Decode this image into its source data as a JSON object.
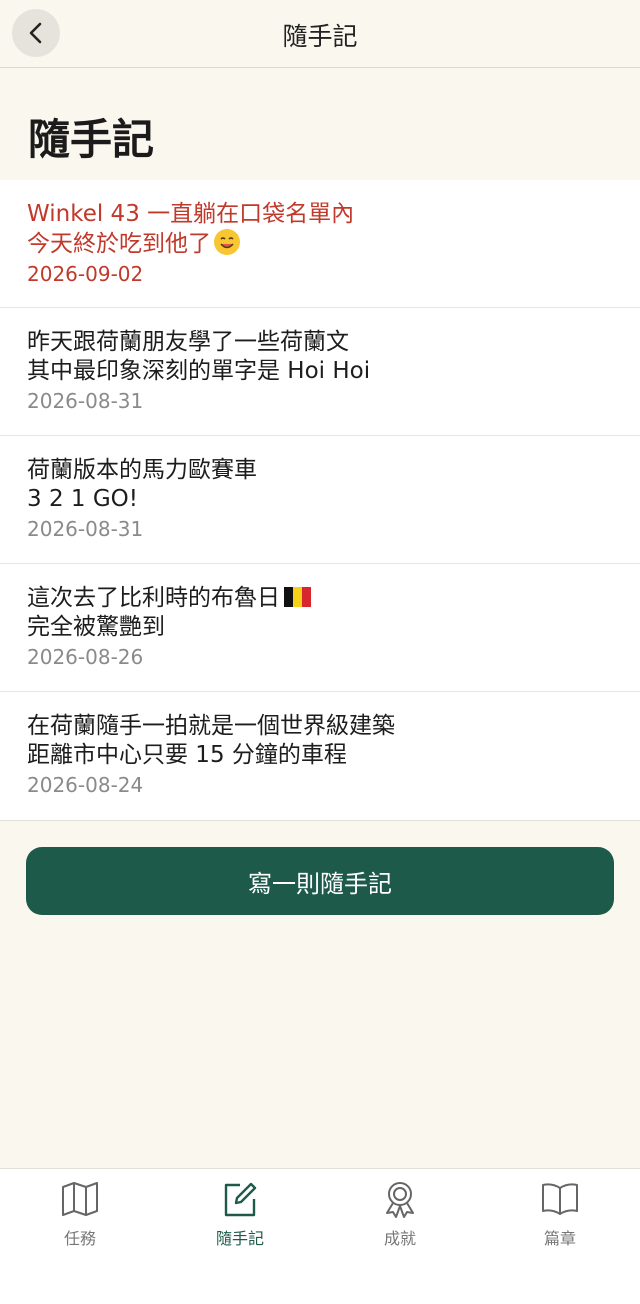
{
  "header": {
    "title": "隨手記"
  },
  "page": {
    "title": "隨手記"
  },
  "notes": [
    {
      "line1": "Winkel 43 一直躺在口袋名單內",
      "line2": "今天終於吃到他了",
      "date": "2026-09-02",
      "emoji": "smiling-face-icon"
    },
    {
      "line1": "昨天跟荷蘭朋友學了一些荷蘭文",
      "line2": "其中最印象深刻的單字是 Hoi Hoi",
      "date": "2026-08-31"
    },
    {
      "line1": "荷蘭版本的馬力歐賽車",
      "line2": "3 2 1 GO!",
      "date": "2026-08-31"
    },
    {
      "line1": "這次去了比利時的布魯日",
      "line2": "完全被驚艷到",
      "date": "2026-08-26",
      "emoji": "belgium-flag-icon"
    },
    {
      "line1": "在荷蘭隨手一拍就是一個世界級建築",
      "line2": "距離市中心只要 15 分鐘的車程",
      "date": "2026-08-24"
    }
  ],
  "actions": {
    "write_label": "寫一則隨手記"
  },
  "tabs": [
    {
      "label": "任務",
      "icon": "map-icon"
    },
    {
      "label": "隨手記",
      "icon": "edit-icon",
      "active": true
    },
    {
      "label": "成就",
      "icon": "award-icon"
    },
    {
      "label": "篇章",
      "icon": "book-icon"
    }
  ],
  "colors": {
    "accent": "#1e5a49",
    "highlight": "#c0392b",
    "background": "#faf7ef"
  }
}
